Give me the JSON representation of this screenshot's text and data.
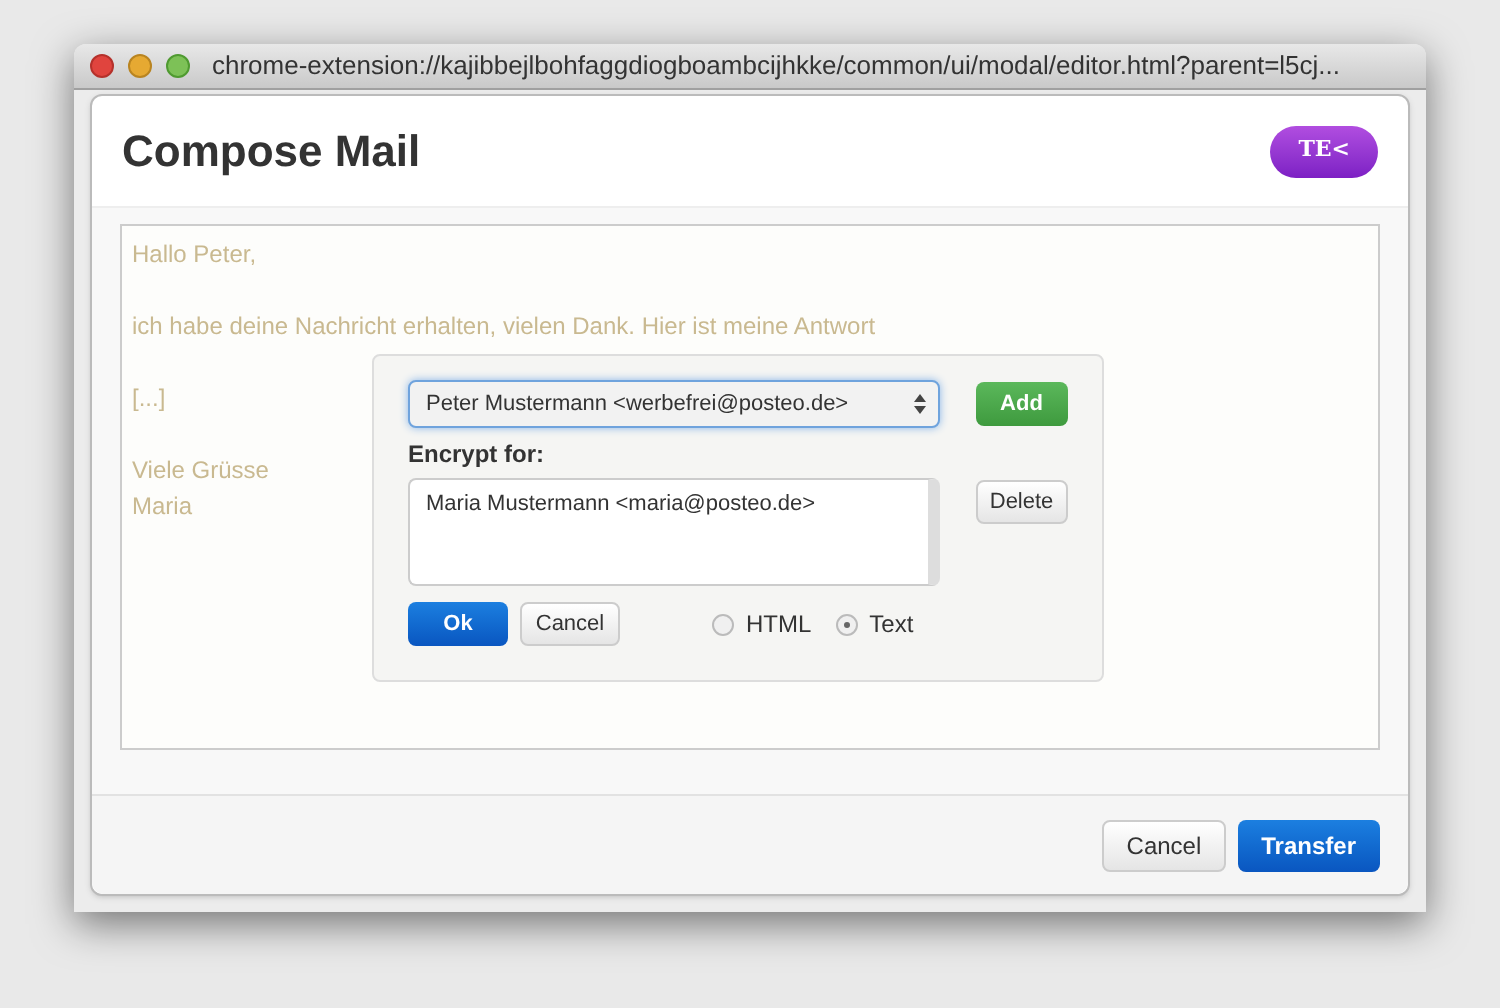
{
  "window": {
    "title": "chrome-extension://kajibbejlbohfaggdiogboambcijhkke/common/ui/modal/editor.html?parent=l5cj..."
  },
  "dialog": {
    "title": "Compose Mail",
    "badge": "TE<"
  },
  "editor": {
    "paragraphs": [
      [
        "Hallo Peter,"
      ],
      [
        "ich habe deine Nachricht erhalten, vielen Dank. Hier ist meine Antwort"
      ],
      [
        "[...]"
      ],
      [
        "Viele Grüsse",
        "Maria"
      ]
    ]
  },
  "encrypt_popup": {
    "recipient_select": "Peter Mustermann <werbefrei@posteo.de>",
    "add_button": "Add",
    "encrypt_label": "Encrypt for:",
    "recipients": [
      "Maria Mustermann <maria@posteo.de>"
    ],
    "delete_button": "Delete",
    "ok_button": "Ok",
    "cancel_button": "Cancel",
    "formats": [
      {
        "label": "HTML",
        "selected": false
      },
      {
        "label": "Text",
        "selected": true
      }
    ]
  },
  "footer": {
    "buttons": [
      {
        "label": "Cancel",
        "kind": "default"
      },
      {
        "label": "Transfer",
        "kind": "primary"
      }
    ]
  }
}
